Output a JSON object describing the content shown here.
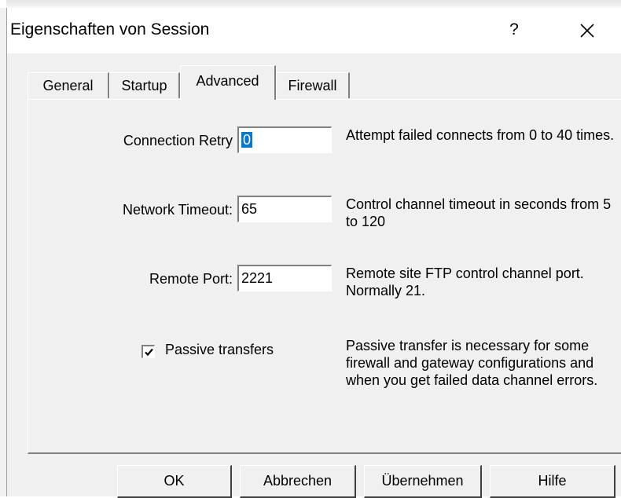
{
  "window": {
    "title": "Eigenschaften von Session",
    "help_label": "?",
    "close_icon": "close-icon"
  },
  "tabs": [
    {
      "label": "General",
      "active": false
    },
    {
      "label": "Startup",
      "active": false
    },
    {
      "label": "Advanced",
      "active": true
    },
    {
      "label": "Firewall",
      "active": false
    }
  ],
  "advanced": {
    "connection_retry": {
      "label": "Connection Retry",
      "value": "0",
      "description": "Attempt failed connects from 0 to 40 times."
    },
    "network_timeout": {
      "label": "Network Timeout:",
      "value": "65",
      "description": "Control channel timeout in seconds from 5 to 120"
    },
    "remote_port": {
      "label": "Remote Port:",
      "value": "2221",
      "description": "Remote site FTP control channel port. Normally 21."
    },
    "passive": {
      "label": "Passive transfers",
      "checked": true,
      "description": "Passive transfer is necessary for some firewall and gateway configurations and when you get failed data channel errors."
    }
  },
  "buttons": {
    "ok": "OK",
    "cancel": "Abbrechen",
    "apply": "Übernehmen",
    "help": "Hilfe"
  },
  "colors": {
    "selection": "#0078d7",
    "dialog_bg": "#f0f0f0"
  }
}
